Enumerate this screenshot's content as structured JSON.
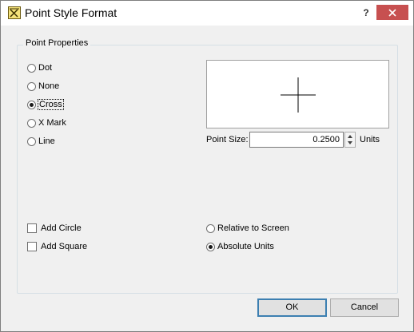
{
  "window": {
    "title": "Point Style Format",
    "help_label": "?",
    "icon": "point-style-app-icon",
    "close_icon": "close-icon"
  },
  "group": {
    "label": "Point Properties"
  },
  "styles": [
    {
      "label": "Dot",
      "checked": false
    },
    {
      "label": "None",
      "checked": false
    },
    {
      "label": "Cross",
      "checked": true
    },
    {
      "label": "X Mark",
      "checked": false
    },
    {
      "label": "Line",
      "checked": false
    }
  ],
  "preview": {
    "shape": "cross"
  },
  "point_size": {
    "label": "Point Size:",
    "value": "0.2500",
    "units": "Units"
  },
  "options": {
    "add_circle": {
      "label": "Add Circle",
      "checked": false
    },
    "add_square": {
      "label": "Add Square",
      "checked": false
    }
  },
  "scaling": [
    {
      "label": "Relative to Screen",
      "checked": false
    },
    {
      "label": "Absolute Units",
      "checked": true
    }
  ],
  "buttons": {
    "ok": "OK",
    "cancel": "Cancel"
  },
  "colors": {
    "close_button": "#c75050",
    "default_button_border": "#3c7fb1",
    "dialog_background": "#f0f0f0"
  }
}
